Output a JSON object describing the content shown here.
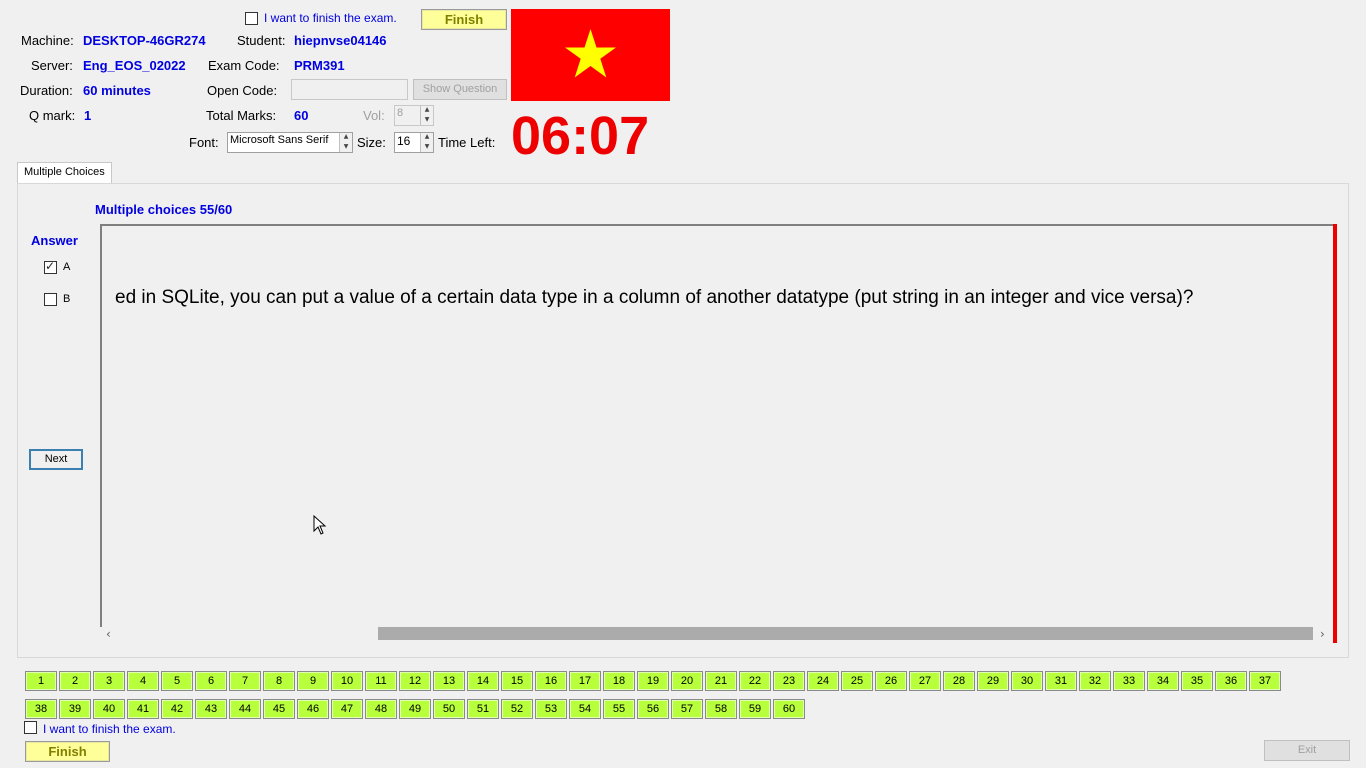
{
  "top": {
    "finish_checkbox_label": "I want to finish the exam.",
    "finish_button": "Finish",
    "machine_label": "Machine:",
    "machine_value": "DESKTOP-46GR274",
    "student_label": "Student:",
    "student_value": "hiepnvse04146",
    "server_label": "Server:",
    "server_value": "Eng_EOS_02022",
    "exam_code_label": "Exam Code:",
    "exam_code_value": "PRM391",
    "duration_label": "Duration:",
    "duration_value": "60 minutes",
    "open_code_label": "Open Code:",
    "open_code_value": "",
    "show_question_button": "Show Question",
    "qmark_label": "Q mark:",
    "qmark_value": "1",
    "total_marks_label": "Total Marks:",
    "total_marks_value": "60",
    "vol_label": "Vol:",
    "vol_value": "8",
    "font_label": "Font:",
    "font_value": "Microsoft Sans Serif",
    "size_label": "Size:",
    "size_value": "16",
    "time_left_label": "Time Left:",
    "time_left_value": "06:07",
    "flag_colors": {
      "background": "#ff0000",
      "star": "#ffff00"
    }
  },
  "tabs": [
    {
      "label": "Multiple Choices"
    }
  ],
  "question": {
    "header": "Multiple choices 55/60",
    "text": "ed in SQLite, you can put a value of a certain data type in a column of another datatype (put string in an integer and vice versa)?",
    "answer_label": "Answer",
    "options": [
      {
        "label": "A",
        "checked": true
      },
      {
        "label": "B",
        "checked": false
      }
    ],
    "next_button": "Next"
  },
  "question_numbers": [
    "1",
    "2",
    "3",
    "4",
    "5",
    "6",
    "7",
    "8",
    "9",
    "10",
    "11",
    "12",
    "13",
    "14",
    "15",
    "16",
    "17",
    "18",
    "19",
    "20",
    "21",
    "22",
    "23",
    "24",
    "25",
    "26",
    "27",
    "28",
    "29",
    "30",
    "31",
    "32",
    "33",
    "34",
    "35",
    "36",
    "37",
    "38",
    "39",
    "40",
    "41",
    "42",
    "43",
    "44",
    "45",
    "46",
    "47",
    "48",
    "49",
    "50",
    "51",
    "52",
    "53",
    "54",
    "55",
    "56",
    "57",
    "58",
    "59",
    "60"
  ],
  "bottom": {
    "finish_checkbox_label": "I want to finish the exam.",
    "finish_button": "Finish",
    "exit_button": "Exit"
  }
}
